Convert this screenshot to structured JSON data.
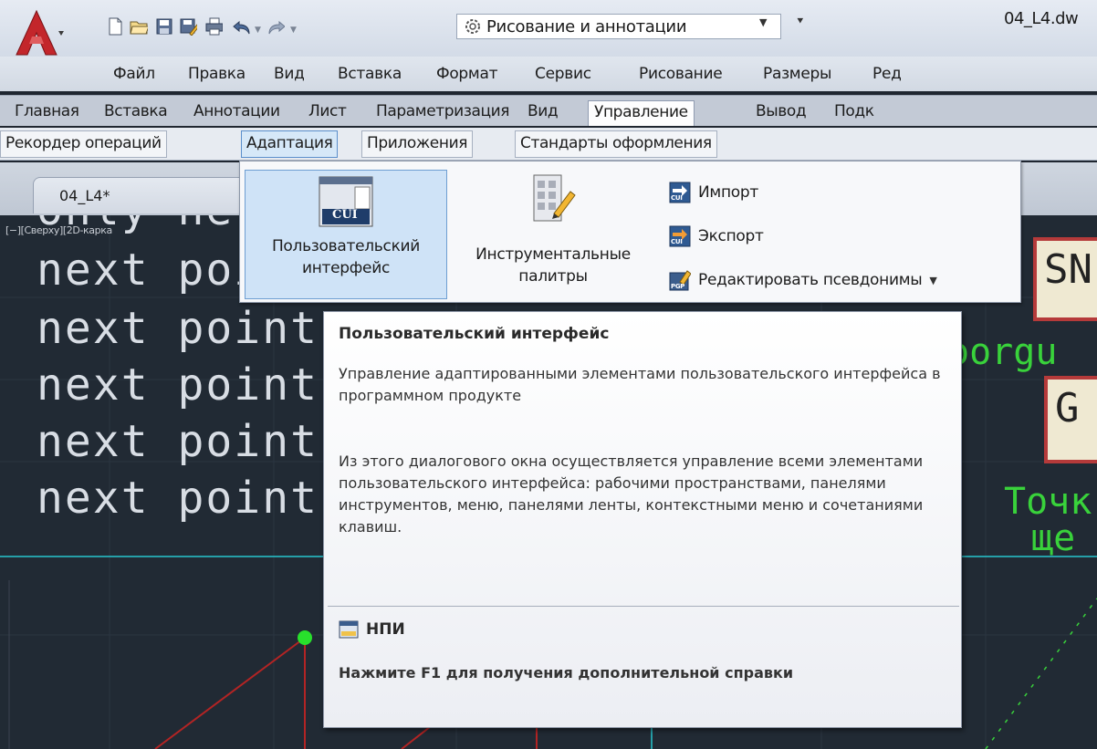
{
  "app": {
    "workspace": "Рисование и аннотации",
    "document_title": "04_L4.dw"
  },
  "menubar": [
    "Файл",
    "Правка",
    "Вид",
    "Вставка",
    "Формат",
    "Сервис",
    "Рисование",
    "Размеры",
    "Ред"
  ],
  "ribbon_tabs": [
    "Главная",
    "Вставка",
    "Аннотации",
    "Лист",
    "Параметризация",
    "Вид",
    "Управление",
    "Вывод",
    "Подк"
  ],
  "panel_tabs": [
    "Рекордер операций",
    "Адаптация",
    "Приложения",
    "Стандарты оформления"
  ],
  "file_tab": "04_L4*",
  "panel": {
    "cui_icon_text": "CUI",
    "cui_line1": "Пользовательский",
    "cui_line2": "интерфейс",
    "tp_line1": "Инструментальные",
    "tp_line2": "палитры",
    "import_label": "Импорт",
    "export_label": "Экспорт",
    "aliases_label": "Редактировать псевдонимы",
    "small_icon_text_1": "CUI",
    "small_icon_text_2": "CUI",
    "small_icon_text_3": "PGP"
  },
  "tooltip": {
    "title": "Пользовательский  интерфейс",
    "desc1": "Управление адаптированными элементами пользовательского интерфейса в программном продукте",
    "desc2": "Из этого диалогового окна осуществляется управление всеми элементами пользовательского интерфейса: рабочими пространствами, панелями инструментов, меню, панелями ленты, контекстными меню и сочетаниями клавиш.",
    "command": "НПИ",
    "help": "Нажмите F1 для получения дополнительной справки"
  },
  "drawing": {
    "viewport_label": "[−][Сверху][2D-карка",
    "text_partial": "only  ne",
    "text_line_1": "next  poi",
    "text_lines": [
      "next  point  c",
      "next  point  c",
      "next  point  c",
      "next  point  c"
    ],
    "btn_snap": "SN",
    "btn_g": "G",
    "green_coord": "oorgu",
    "green_point": "Точк",
    "green_sche": "ще"
  },
  "colors": {
    "accent_blue": "#cfe3f7",
    "autocad_red": "#c3262b",
    "drawing_bg": "#212a34",
    "cad_green": "#39d23b",
    "cad_red": "#b32424",
    "cad_cyan": "#27c6cf"
  }
}
